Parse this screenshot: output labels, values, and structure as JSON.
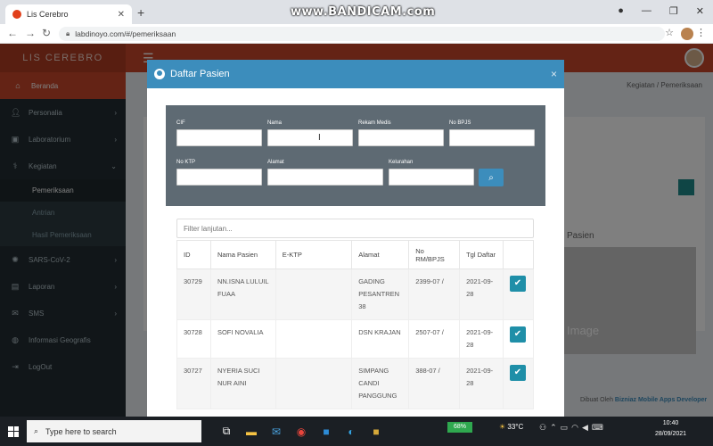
{
  "browser": {
    "tab_title": "Lis Cerebro",
    "recorder_watermark": "www.BANDICAM.com",
    "url": "labdinoyo.com/#/pemeriksaan"
  },
  "app": {
    "logo": "LIS CEREBRO",
    "breadcrumb": "Kegiatan  /  Pemeriksaan",
    "sidebar": {
      "items": [
        {
          "label": "Beranda",
          "icon": "home-icon",
          "active": true
        },
        {
          "label": "Personalia",
          "icon": "user-icon"
        },
        {
          "label": "Laboratorium",
          "icon": "lab-icon"
        },
        {
          "label": "Kegiatan",
          "icon": "stethoscope-icon"
        },
        {
          "label": "SARS-CoV-2",
          "icon": "virus-icon"
        },
        {
          "label": "Laporan",
          "icon": "report-icon"
        },
        {
          "label": "SMS",
          "icon": "sms-icon"
        },
        {
          "label": "Informasi Geografis",
          "icon": "globe-icon"
        },
        {
          "label": "LogOut",
          "icon": "logout-icon"
        }
      ],
      "subitems": [
        "Pemeriksaan",
        "Antrian",
        "Hasil Pemeriksaan"
      ]
    },
    "background_panel_title": "Pasien",
    "background_image_label": "Image",
    "footer_prefix": "Dibuat Oleh",
    "footer_brand": "Bizniaz Mobile Apps Developer"
  },
  "modal": {
    "title": "Daftar Pasien",
    "close": "×",
    "filters": {
      "cif": "CIF",
      "nama": "Nama",
      "rekam_medis": "Rekam Medis",
      "no_bpjs": "No BPJS",
      "no_ktp": "No KTP",
      "alamat": "Alamat",
      "kelurahan": "Kelurahan"
    },
    "search_placeholder": "Filter lanjutan...",
    "table": {
      "headers": [
        "ID",
        "Nama Pasien",
        "E-KTP",
        "Alamat",
        "No RM/BPJS",
        "Tgl Daftar",
        ""
      ],
      "rows": [
        {
          "id": "30729",
          "nama": "NN.ISNA LULUIL FUAA",
          "ektp": "",
          "alamat": "GADING PESANTREN 38",
          "norm": "2399-07 /",
          "tgl": "2021-09-28"
        },
        {
          "id": "30728",
          "nama": "SOFI NOVALIA",
          "ektp": "",
          "alamat": "DSN KRAJAN",
          "norm": "2507-07 /",
          "tgl": "2021-09-28"
        },
        {
          "id": "30727",
          "nama": "NYERIA SUCI NUR AINI",
          "ektp": "",
          "alamat": "SIMPANG CANDI PANGGUNG",
          "norm": "388-07 /",
          "tgl": "2021-09-28"
        }
      ]
    }
  },
  "taskbar": {
    "search_placeholder": "Type here to search",
    "cpu": "68%",
    "weather": "33°C",
    "time": "10:40",
    "date": "28/09/2021"
  }
}
